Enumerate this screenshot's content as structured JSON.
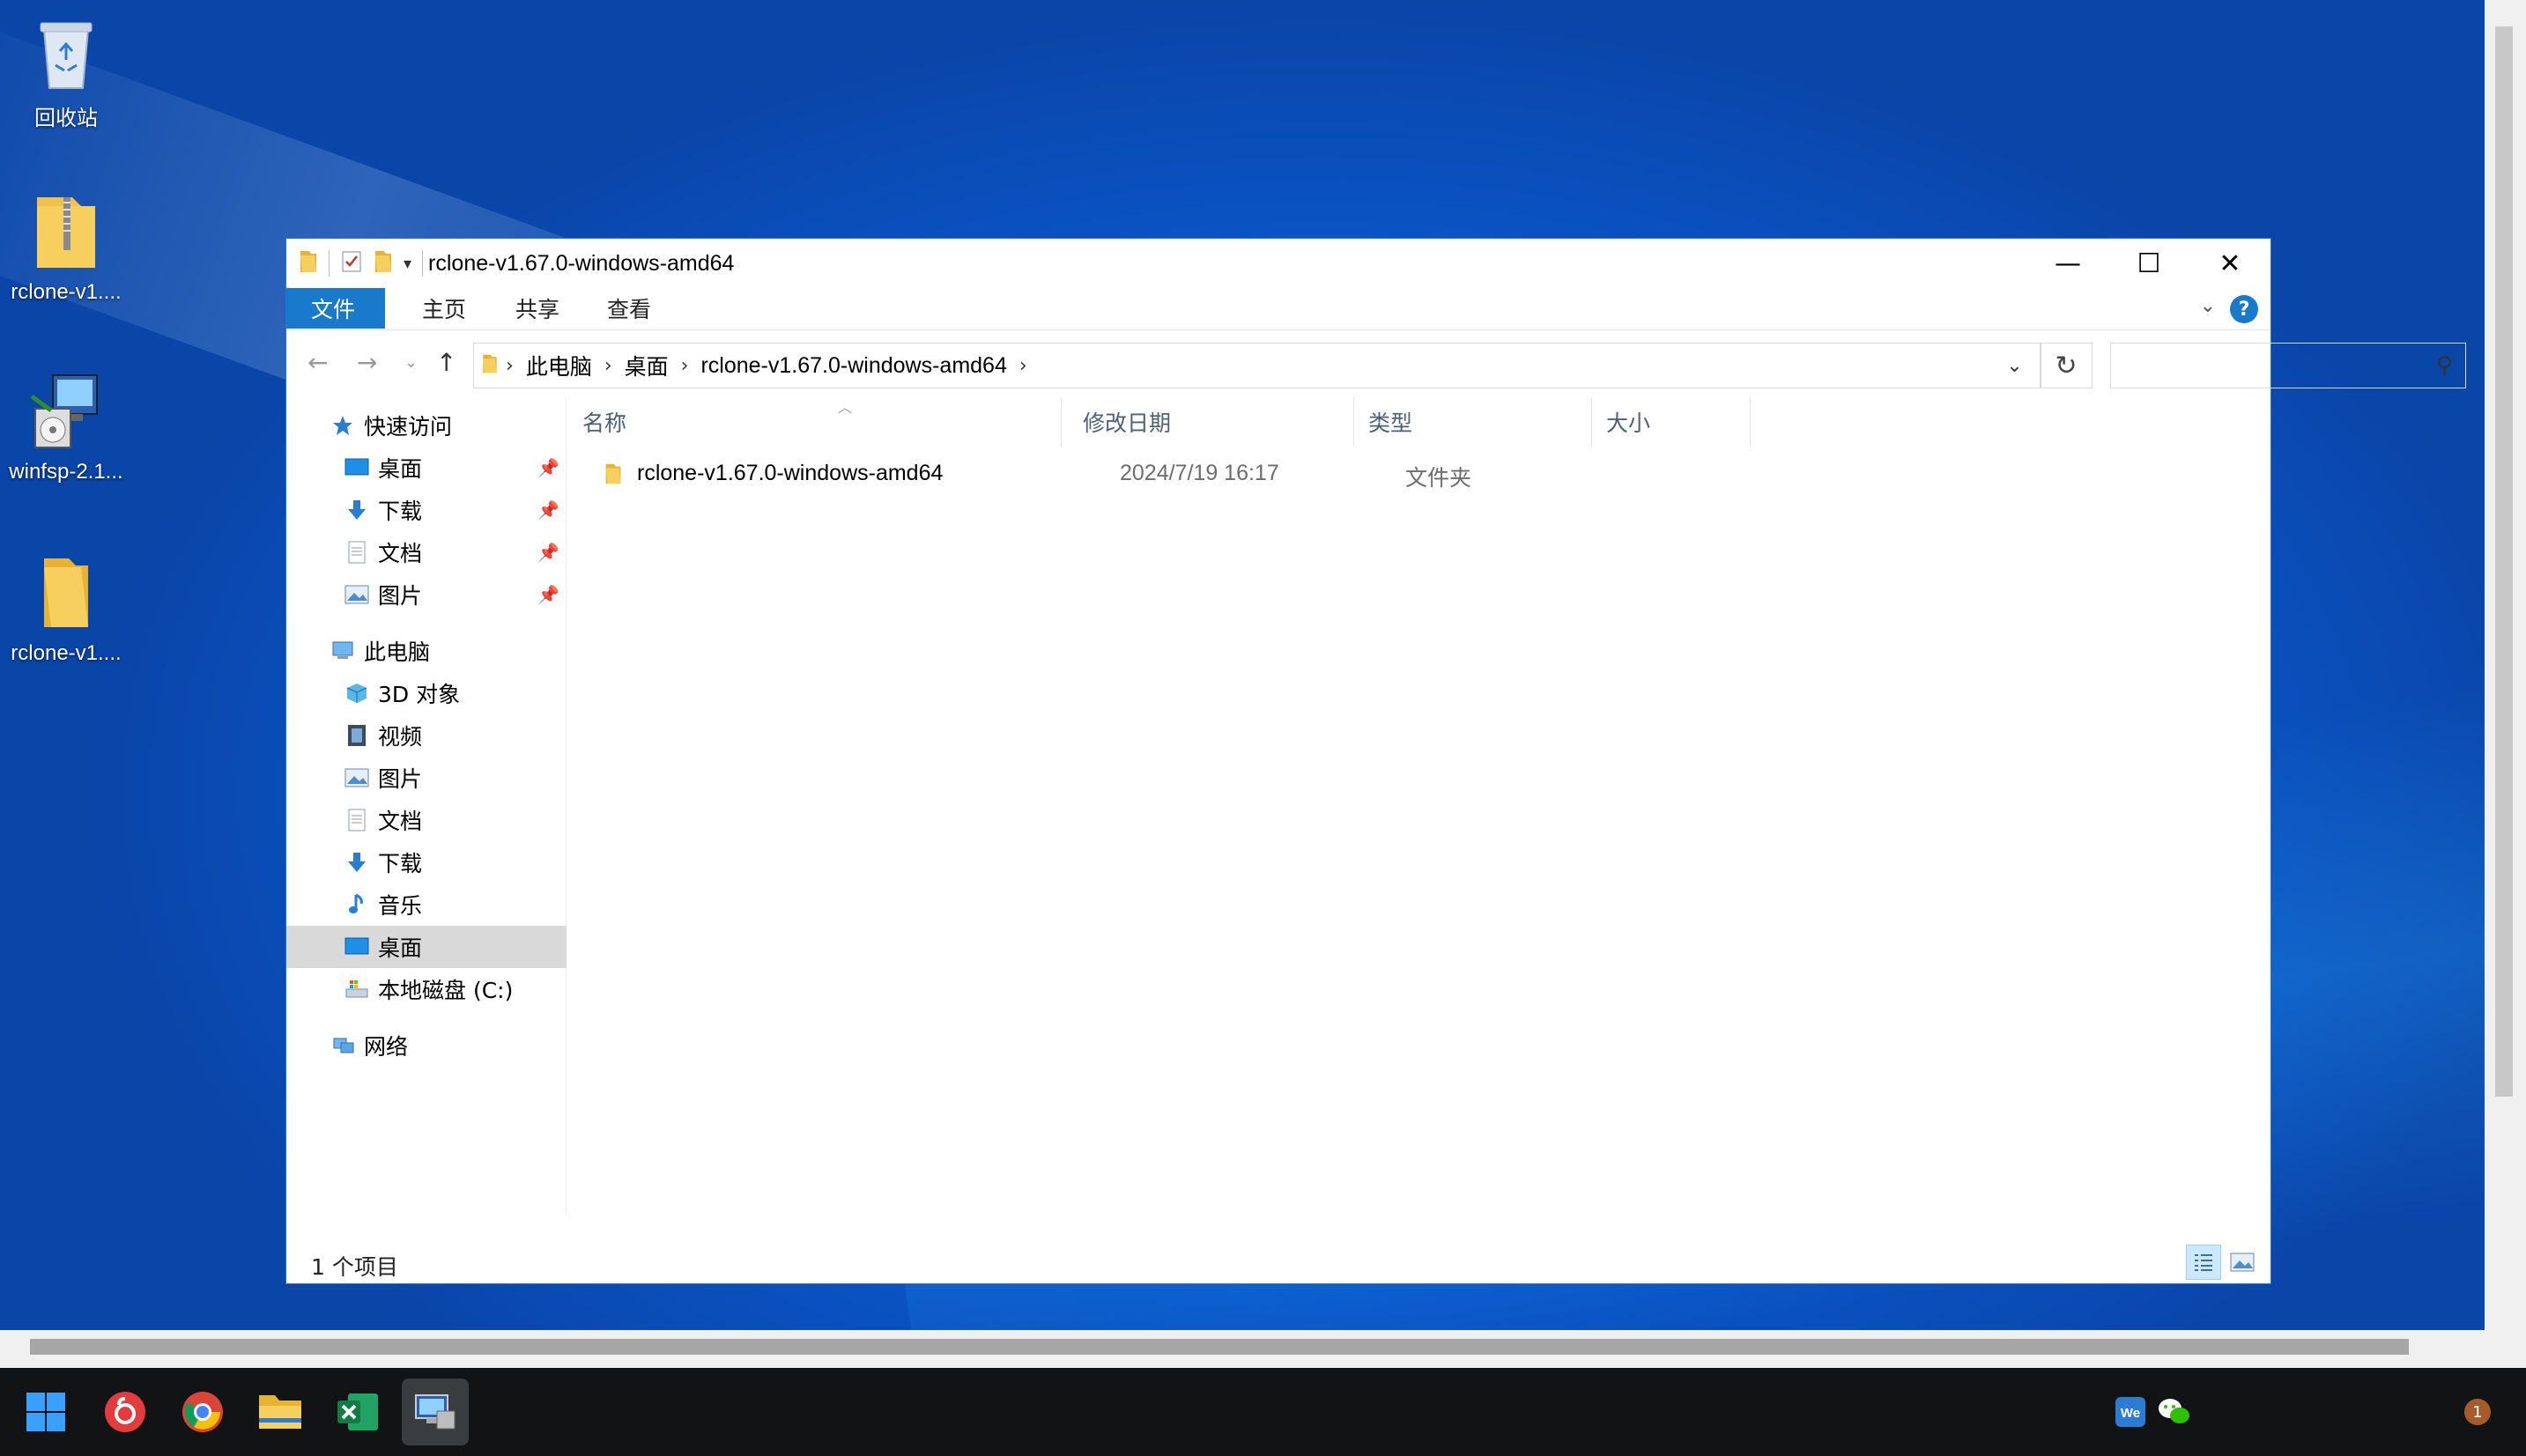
{
  "desktop": {
    "icons": [
      {
        "label": "回收站",
        "icon": "recycle-bin-icon"
      },
      {
        "label": "rclone-v1....",
        "icon": "zip-folder-icon"
      },
      {
        "label": "winfsp-2.1...",
        "icon": "installer-icon"
      },
      {
        "label": "rclone-v1....",
        "icon": "folder-icon"
      }
    ]
  },
  "window": {
    "title": "rclone-v1.67.0-windows-amd64",
    "controls": {
      "minimize": "—",
      "maximize": "☐",
      "close": "✕"
    },
    "ribbon": {
      "tabs": [
        "文件",
        "主页",
        "共享",
        "查看"
      ],
      "help": "?"
    },
    "address": {
      "crumbs": [
        "此电脑",
        "桌面",
        "rclone-v1.67.0-windows-amd64"
      ],
      "search_placeholder": ""
    },
    "nav": {
      "quick_access": "快速访问",
      "quick_items": [
        "桌面",
        "下载",
        "文档",
        "图片"
      ],
      "this_pc": "此电脑",
      "pc_items": [
        "3D 对象",
        "视频",
        "图片",
        "文档",
        "下载",
        "音乐",
        "桌面",
        "本地磁盘 (C:)"
      ],
      "network": "网络",
      "selected": "桌面"
    },
    "columns": {
      "name": "名称",
      "modified": "修改日期",
      "type": "类型",
      "size": "大小"
    },
    "files": [
      {
        "name": "rclone-v1.67.0-windows-amd64",
        "modified": "2024/7/19 16:17",
        "type": "文件夹",
        "size": ""
      }
    ],
    "status": "1 个项目"
  },
  "taskbar": {
    "apps": [
      "start-icon",
      "netease-music-icon",
      "chrome-icon",
      "file-explorer-icon",
      "excel-icon",
      "remote-desktop-icon"
    ],
    "tray": {
      "notification_count": "1"
    }
  },
  "colors": {
    "accent": "#1979ca",
    "folder": "#f0c24b",
    "taskbar": "#111315"
  }
}
